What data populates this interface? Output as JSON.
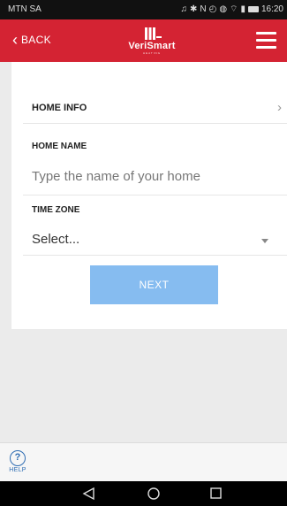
{
  "status_bar": {
    "carrier": "MTN SA",
    "icons": [
      "headphones-icon",
      "bluetooth-icon",
      "nfc-icon",
      "alarm-icon",
      "vibrate-icon",
      "wifi-icon",
      "signal-icon",
      "battery-icon"
    ],
    "time": "16:20"
  },
  "header": {
    "back_label": "BACK",
    "logo_text": "VeriSmart",
    "logo_sub": "HEATING",
    "brand_color": "#d42333"
  },
  "form": {
    "section_title": "HOME INFO",
    "home_name_label": "HOME NAME",
    "home_name_placeholder": "Type the name of your home",
    "time_zone_label": "TIME ZONE",
    "time_zone_value": "Select...",
    "next_label": "NEXT",
    "next_color": "#86bcf0"
  },
  "footer": {
    "help_label": "HELP",
    "help_symbol": "?"
  }
}
